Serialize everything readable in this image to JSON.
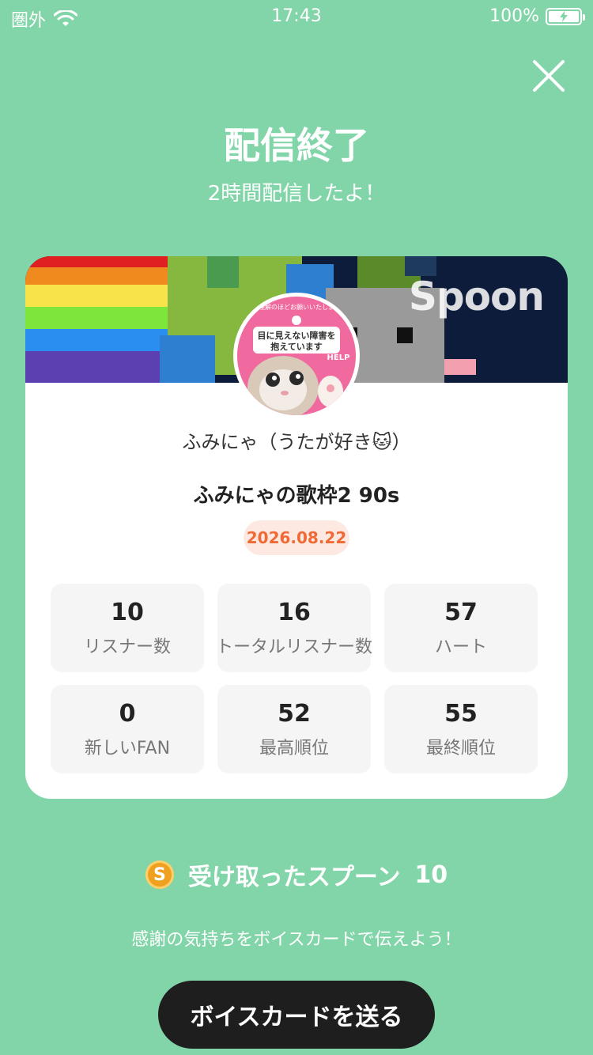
{
  "status_bar": {
    "carrier": "圏外",
    "time": "17:43",
    "battery": "100%"
  },
  "header": {
    "title": "配信終了",
    "subtitle": "2時間配信したよ！",
    "close_icon": "close-icon"
  },
  "card": {
    "banner_logo": "Spoon",
    "avatar_text": "目に見えない障害を抱えています",
    "avatar_top_text": "ご理解のほどお願いいたします",
    "avatar_help": "HELP",
    "dj_name": "ふみにゃ（うたが好き🐱）",
    "live_title": "ふみにゃの歌枠2 90s",
    "date": "2026.08.22",
    "stats": [
      {
        "value": "10",
        "label": "リスナー数"
      },
      {
        "value": "16",
        "label": "トータルリスナー数"
      },
      {
        "value": "57",
        "label": "ハート"
      },
      {
        "value": "0",
        "label": "新しいFAN"
      },
      {
        "value": "52",
        "label": "最高順位"
      },
      {
        "value": "55",
        "label": "最終順位"
      }
    ]
  },
  "spoons": {
    "coin_letter": "S",
    "label": "受け取ったスプーン",
    "count": "10"
  },
  "thanks_text": "感謝の気持ちをボイスカードで伝えよう！",
  "send_button": "ボイスカードを送る",
  "colors": {
    "background": "#82d5a8",
    "date_badge_text": "#f06a35",
    "button": "#1e1e1e"
  }
}
